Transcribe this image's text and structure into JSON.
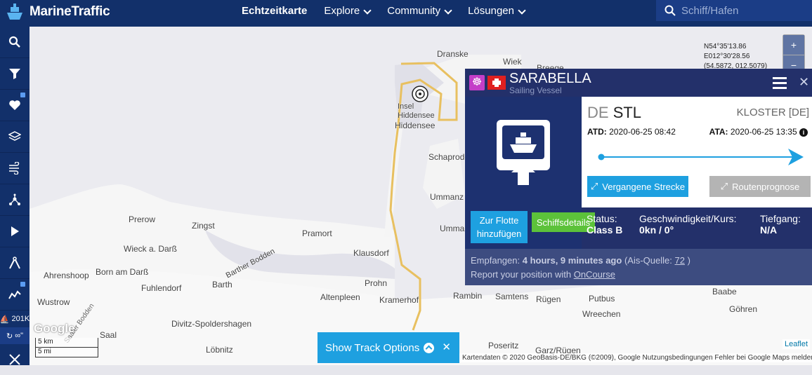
{
  "brand": {
    "name": "MarineTraffic"
  },
  "nav": {
    "items": [
      "Echtzeitkarte",
      "Explore",
      "Community",
      "Lösungen"
    ]
  },
  "search": {
    "placeholder": "Schiff/Hafen"
  },
  "sidebar": {
    "vessel_count": "201K",
    "track_label": "∞\""
  },
  "map": {
    "coords": [
      "N54°35'13.86",
      "E012°30'28.56",
      "(54.5872, 012.5079)"
    ],
    "zoom_in": "+",
    "zoom_out": "−",
    "places": [
      "Dranske",
      "Wiek",
      "Breege",
      "Insel Hiddensee",
      "Hiddensee",
      "Schaprode",
      "Ummanz",
      "Ummanz",
      "Prerow",
      "Zingst",
      "Pramort",
      "Wieck a. Darß",
      "Born am Darß",
      "Ahrenshoop",
      "Fuhlendorf",
      "Barther Bodden",
      "Klausdorf",
      "Barth",
      "Prohn",
      "Altenpleen",
      "Kramerhof",
      "Wustrow",
      "Rambin",
      "Samtens",
      "Rügen",
      "Putbus",
      "Wreechen",
      "Baabe",
      "Göhren",
      "Divitz-Spoldershagen",
      "Saal",
      "Löbnitz",
      "Poseritz",
      "Garz/Rügen",
      "Saaler Bodden"
    ],
    "google": "Google",
    "scale_km": "5 km",
    "scale_mi": "5 mi",
    "attribution": "Kartendaten © 2020 GeoBasis-DE/BKG (©2009), Google   Nutzungsbedingungen   Fehler bei Google Maps melden",
    "leaflet": "Leaflet"
  },
  "popup": {
    "name": "SARABELLA",
    "type": "Sailing Vessel",
    "from_cc": "DE",
    "from_port": "STL",
    "to": "KLOSTER [DE]",
    "atd_label": "ATD:",
    "atd": "2020-06-25 08:42",
    "ata_label": "ATA:",
    "ata": "2020-06-25 13:35",
    "past_track": "Vergangene Strecke",
    "forecast": "Routenprognose",
    "fleet_btn_1": "Zur Flotte",
    "fleet_btn_2": "hinzufügen",
    "details_btn": "Schiffsdetails",
    "status_label": "Status:",
    "status": "Class B",
    "speed_label": "Geschwindigkeit/Kurs:",
    "speed": "0kn / 0°",
    "draught_label": "Tiefgang:",
    "draught": "N/A",
    "received_label": "Empfangen:",
    "received": "4 hours, 9 minutes ago",
    "source_prefix": "(Ais-Quelle:",
    "source_id": "72",
    "source_suffix": ")",
    "report_prefix": "Report your position with",
    "report_link": "OnCourse"
  },
  "track": {
    "label": "Show Track Options",
    "close": "✕"
  },
  "colors": {
    "navy": "#12306a",
    "accent": "#1ea0e0",
    "green": "#5cc23a",
    "track": "#e8c060"
  }
}
